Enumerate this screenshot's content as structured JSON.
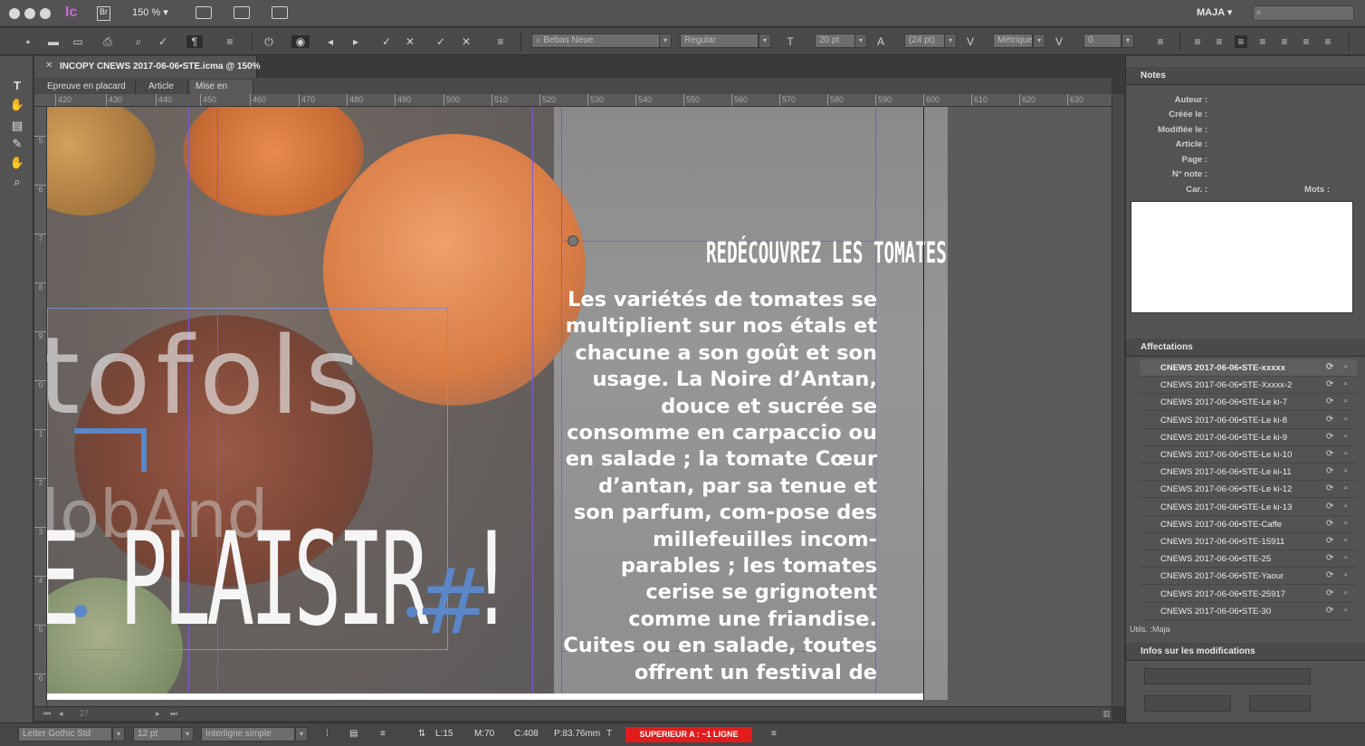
{
  "app": {
    "logo": "Ic",
    "bridge": "Br",
    "zoom": "150 %",
    "user": "MAJA"
  },
  "control": {
    "font": "Bebas Neue",
    "style": "Regular",
    "size": "20 pt",
    "leading": "(24 pt)",
    "kerning": "Métrique",
    "tracking": "0"
  },
  "document": {
    "tab_title": "INCOPY CNEWS 2017-06-06•STE.icma @ 150%",
    "view_tabs": [
      "Epreuve en placard",
      "Article",
      "Mise en page"
    ],
    "ruler_ticks": [
      "420",
      "430",
      "440",
      "450",
      "460",
      "470",
      "480",
      "490",
      "500",
      "510",
      "520",
      "530",
      "540",
      "550",
      "560",
      "570",
      "580",
      "590",
      "600",
      "610",
      "620",
      "630"
    ],
    "vruler_ticks": [
      "5",
      "6",
      "7",
      "8",
      "9",
      "0",
      "1",
      "2",
      "3",
      "4",
      "5",
      "6"
    ],
    "page_number": "27",
    "bg_word": "tofols",
    "bg_sub": "lobAnd",
    "bg_plaisir": "E PLAISIR !",
    "hash": "#",
    "headline": "REDÉCOUVREZ LES TOMATES",
    "body": "Les variétés de tomates se multiplient sur nos étals et chacune a son goût et son usage. La Noire d’Antan, douce et sucrée se consomme en carpaccio ou en salade ; la tomate Cœur d’antan, par sa tenue et son parfum, com-pose des millefeuilles incom-parables ; les tomates cerise se grignotent comme une friandise. Cuites ou en salade, toutes offrent un festival de"
  },
  "notes": {
    "title": "Notes",
    "labels": [
      "Auteur :",
      "Créée le :",
      "Modifiée le :",
      "Article :",
      "Page :",
      "N° note :",
      "Car. :"
    ],
    "words_label": "Mots :"
  },
  "affectations": {
    "title": "Affectations",
    "items": [
      "CNEWS 2017-06-06•STE-xxxxx",
      "CNEWS 2017-06-06•STE-Xxxxx-2",
      "CNEWS 2017-06-06•STE-Le ki-7",
      "CNEWS 2017-06-06•STE-Le ki-8",
      "CNEWS 2017-06-06•STE-Le ki-9",
      "CNEWS 2017-06-06•STE-Le ki-10",
      "CNEWS 2017-06-06•STE-Le ki-11",
      "CNEWS 2017-06-06•STE-Le ki-12",
      "CNEWS 2017-06-06•STE-Le ki-13",
      "CNEWS 2017-06-06•STE-Caffe",
      "CNEWS 2017-06-06•STE-15911",
      "CNEWS 2017-06-06•STE-25",
      "CNEWS 2017-06-06•STE-Yaour",
      "CNEWS 2017-06-06•STE-25917",
      "CNEWS 2017-06-06•STE-30"
    ],
    "footer_user": "Utils. :Maja"
  },
  "modifications": {
    "title": "Infos sur les modifications"
  },
  "status": {
    "font": "Letter Gothic Std",
    "size": "12 pt",
    "leading": "Interligne simple",
    "lines": "L:15",
    "words": "M:70",
    "chars": "C:408",
    "depth": "P:83.76mm",
    "alert": "SUPERIEUR A : ~1 LIGNE"
  },
  "colors": {
    "guide": "#7a5ad6",
    "accent_blue": "#5b86c8",
    "alert_red": "#e21c1c",
    "logo_purple": "#c56dd1"
  }
}
